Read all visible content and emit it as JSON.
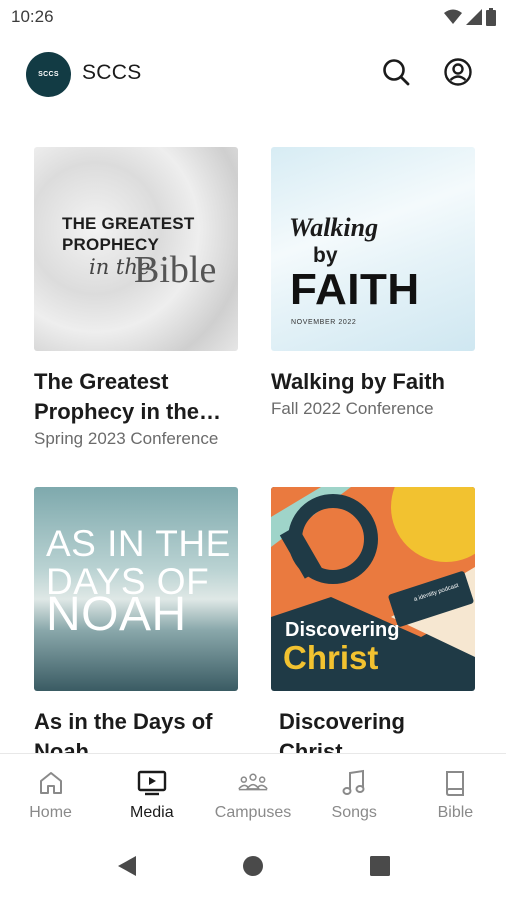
{
  "status_bar": {
    "time": "10:26",
    "icons": [
      "wifi-icon",
      "cell-signal-icon",
      "battery-icon"
    ]
  },
  "header": {
    "logo_text": "SCCS",
    "title": "SCCS",
    "actions": [
      "search-icon",
      "account-icon"
    ]
  },
  "media": [
    {
      "title": "The Greatest Prophecy in the Bible",
      "subtitle": "Spring 2023 Conference",
      "art": {
        "line1": "THE GREATEST PROPHECY",
        "line2": "in the",
        "line3": "Bible"
      }
    },
    {
      "title": "Walking by Faith",
      "subtitle": "Fall 2022 Conference",
      "art": {
        "line1": "Walking",
        "line2": "by",
        "line3": "FAITH",
        "line4": "NOVEMBER 2022"
      }
    },
    {
      "title": "As in the Days of Noah",
      "subtitle": "",
      "art": {
        "line1": "AS IN THE DAYS OF",
        "line3": "NOAH"
      }
    },
    {
      "title": "Discovering Christ",
      "subtitle": "",
      "art": {
        "line1": "Discovering",
        "line2": "Christ",
        "badge": "a identity podcast"
      }
    }
  ],
  "bottom_nav": {
    "items": [
      {
        "label": "Home",
        "icon": "home-icon"
      },
      {
        "label": "Media",
        "icon": "media-icon",
        "active": true
      },
      {
        "label": "Campuses",
        "icon": "campuses-icon"
      },
      {
        "label": "Songs",
        "icon": "music-note-icon"
      },
      {
        "label": "Bible",
        "icon": "book-icon"
      }
    ]
  },
  "colors": {
    "logo_bg": "#123b44",
    "accent_yellow": "#f2c230",
    "inactive": "#8a8a8a"
  }
}
